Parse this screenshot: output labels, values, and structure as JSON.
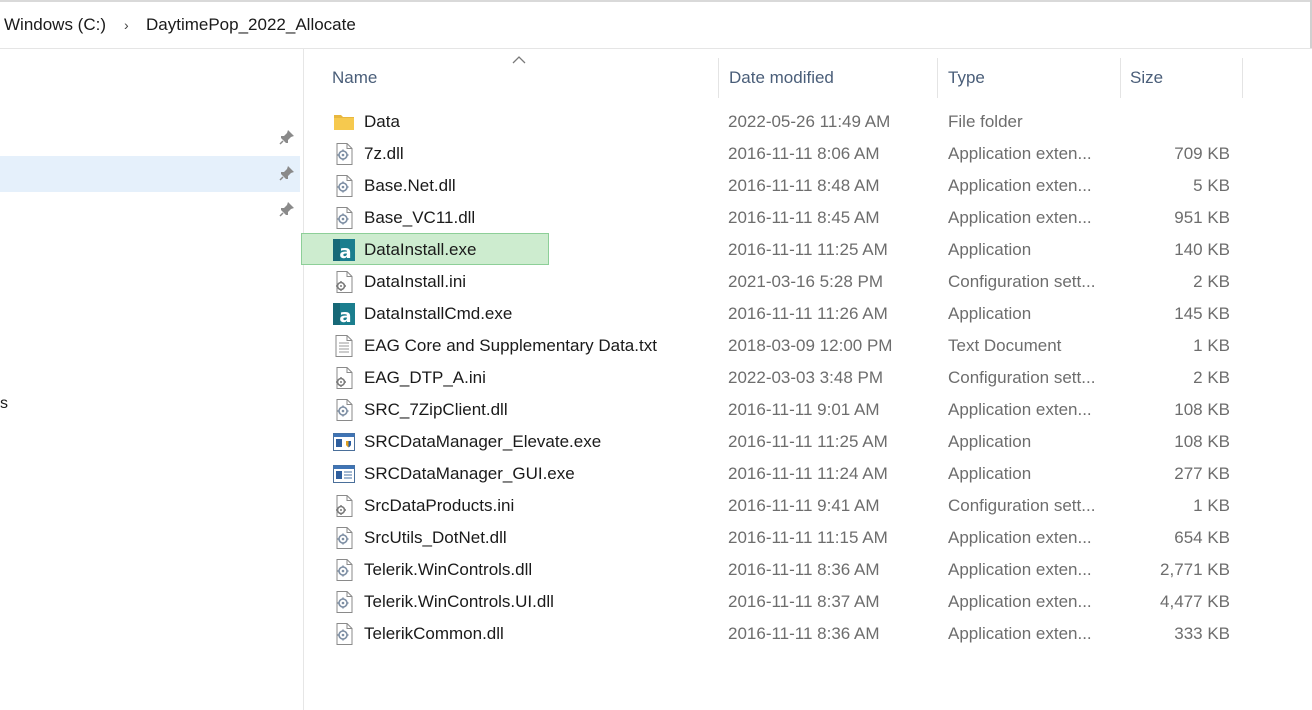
{
  "breadcrumb": {
    "items": [
      "Windows (C:)",
      "DaytimePop_2022_Allocate"
    ],
    "separator": "›"
  },
  "nav": {
    "partial_label": "s"
  },
  "columns": {
    "name": "Name",
    "date": "Date modified",
    "type": "Type",
    "size": "Size"
  },
  "files": [
    {
      "name": "Data",
      "date": "2022-05-26 11:49 AM",
      "type": "File folder",
      "size": "",
      "icon": "folder-icon"
    },
    {
      "name": "7z.dll",
      "date": "2016-11-11 8:06 AM",
      "type": "Application exten...",
      "size": "709 KB",
      "icon": "dll-icon"
    },
    {
      "name": "Base.Net.dll",
      "date": "2016-11-11 8:48 AM",
      "type": "Application exten...",
      "size": "5 KB",
      "icon": "dll-icon"
    },
    {
      "name": "Base_VC11.dll",
      "date": "2016-11-11 8:45 AM",
      "type": "Application exten...",
      "size": "951 KB",
      "icon": "dll-icon"
    },
    {
      "name": "DataInstall.exe",
      "date": "2016-11-11 11:25 AM",
      "type": "Application",
      "size": "140 KB",
      "icon": "app-a-icon"
    },
    {
      "name": "DataInstall.ini",
      "date": "2021-03-16 5:28 PM",
      "type": "Configuration sett...",
      "size": "2 KB",
      "icon": "ini-icon"
    },
    {
      "name": "DataInstallCmd.exe",
      "date": "2016-11-11 11:26 AM",
      "type": "Application",
      "size": "145 KB",
      "icon": "app-a-icon"
    },
    {
      "name": "EAG Core and Supplementary Data.txt",
      "date": "2018-03-09 12:00 PM",
      "type": "Text Document",
      "size": "1 KB",
      "icon": "txt-icon"
    },
    {
      "name": "EAG_DTP_A.ini",
      "date": "2022-03-03 3:48 PM",
      "type": "Configuration sett...",
      "size": "2 KB",
      "icon": "ini-icon"
    },
    {
      "name": "SRC_7ZipClient.dll",
      "date": "2016-11-11 9:01 AM",
      "type": "Application exten...",
      "size": "108 KB",
      "icon": "dll-icon"
    },
    {
      "name": "SRCDataManager_Elevate.exe",
      "date": "2016-11-11 11:25 AM",
      "type": "Application",
      "size": "108 KB",
      "icon": "exe-shield-icon"
    },
    {
      "name": "SRCDataManager_GUI.exe",
      "date": "2016-11-11 11:24 AM",
      "type": "Application",
      "size": "277 KB",
      "icon": "exe-window-icon"
    },
    {
      "name": "SrcDataProducts.ini",
      "date": "2016-11-11 9:41 AM",
      "type": "Configuration sett...",
      "size": "1 KB",
      "icon": "ini-icon"
    },
    {
      "name": "SrcUtils_DotNet.dll",
      "date": "2016-11-11 11:15 AM",
      "type": "Application exten...",
      "size": "654 KB",
      "icon": "dll-icon"
    },
    {
      "name": "Telerik.WinControls.dll",
      "date": "2016-11-11 8:36 AM",
      "type": "Application exten...",
      "size": "2,771 KB",
      "icon": "dll-icon"
    },
    {
      "name": "Telerik.WinControls.UI.dll",
      "date": "2016-11-11 8:37 AM",
      "type": "Application exten...",
      "size": "4,477 KB",
      "icon": "dll-icon"
    },
    {
      "name": "TelerikCommon.dll",
      "date": "2016-11-11 8:36 AM",
      "type": "Application exten...",
      "size": "333 KB",
      "icon": "dll-icon"
    }
  ],
  "highlighted_file": "DataInstall.exe",
  "colors": {
    "highlight_fill": "#cdeccf",
    "highlight_border": "#8dcf98",
    "nav_selected": "#e5f0fb",
    "header_text": "#4a5e79",
    "folder_yellow": "#f6c94e",
    "app_teal": "#1b7e8e"
  }
}
